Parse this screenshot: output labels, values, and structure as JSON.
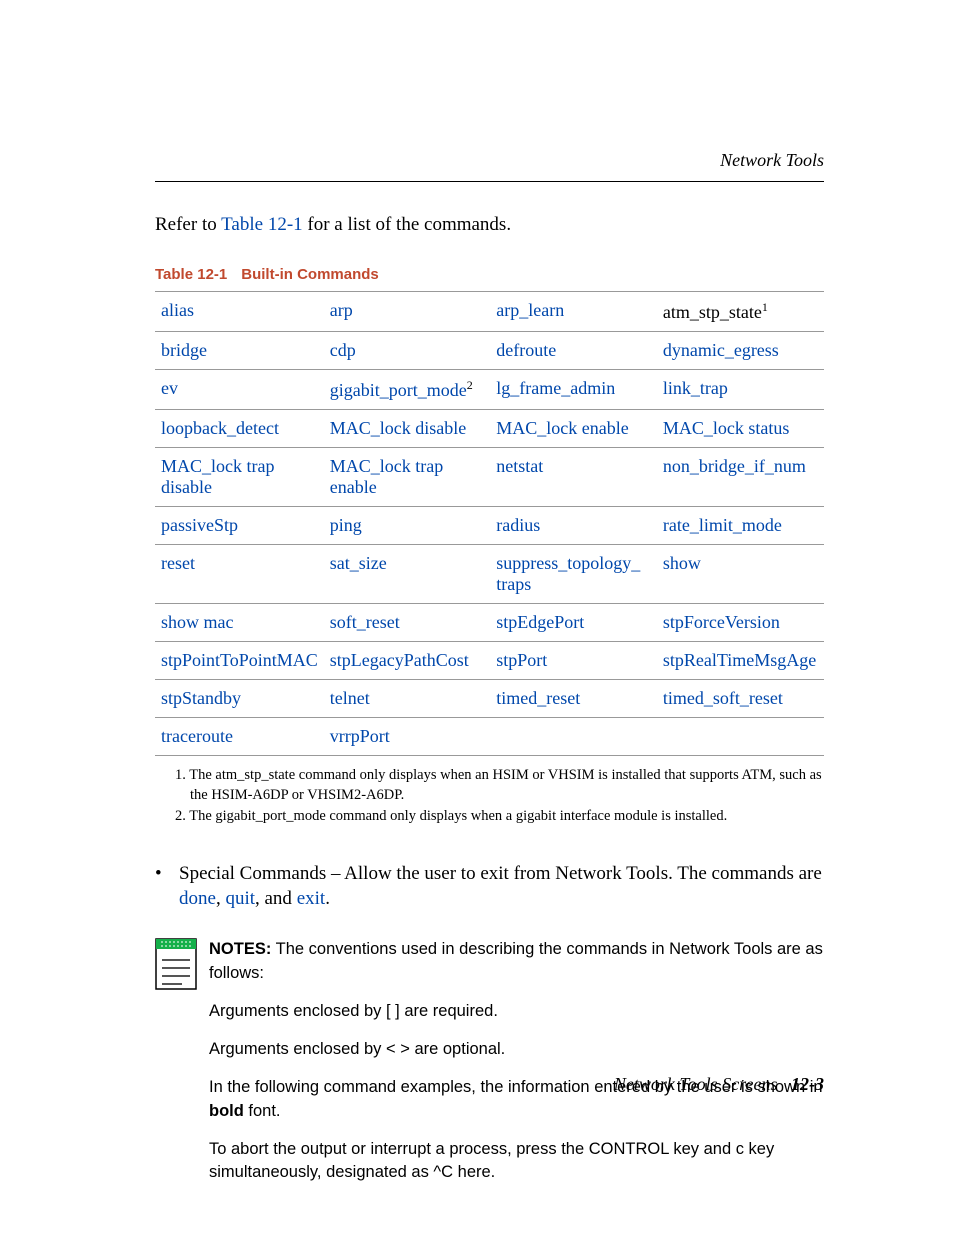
{
  "header": {
    "section": "Network Tools"
  },
  "intro": {
    "pre": "Refer to ",
    "link": "Table 12-1",
    "post": " for a list of the commands."
  },
  "table": {
    "number": "Table 12-1",
    "title": "Built-in Commands",
    "rows": [
      [
        {
          "t": "alias",
          "sup": ""
        },
        {
          "t": "arp",
          "sup": ""
        },
        {
          "t": "arp_learn",
          "sup": ""
        },
        {
          "t": "atm_stp_state",
          "sup": "1",
          "plain": true
        }
      ],
      [
        {
          "t": "bridge",
          "sup": ""
        },
        {
          "t": "cdp",
          "sup": ""
        },
        {
          "t": "defroute",
          "sup": ""
        },
        {
          "t": "dynamic_egress",
          "sup": ""
        }
      ],
      [
        {
          "t": "ev",
          "sup": ""
        },
        {
          "t": "gigabit_port_mode",
          "sup": "2"
        },
        {
          "t": "lg_frame_admin",
          "sup": ""
        },
        {
          "t": "link_trap",
          "sup": ""
        }
      ],
      [
        {
          "t": "loopback_detect",
          "sup": ""
        },
        {
          "t": "MAC_lock disable",
          "sup": ""
        },
        {
          "t": "MAC_lock enable",
          "sup": ""
        },
        {
          "t": "MAC_lock status",
          "sup": ""
        }
      ],
      [
        {
          "t": "MAC_lock trap disable",
          "sup": ""
        },
        {
          "t": "MAC_lock trap enable",
          "sup": ""
        },
        {
          "t": "netstat",
          "sup": ""
        },
        {
          "t": "non_bridge_if_num",
          "sup": ""
        }
      ],
      [
        {
          "t": "passiveStp",
          "sup": ""
        },
        {
          "t": "ping",
          "sup": ""
        },
        {
          "t": "radius",
          "sup": ""
        },
        {
          "t": "rate_limit_mode",
          "sup": ""
        }
      ],
      [
        {
          "t": "reset",
          "sup": ""
        },
        {
          "t": "sat_size",
          "sup": ""
        },
        {
          "t": "suppress_topology_ traps",
          "sup": ""
        },
        {
          "t": "show",
          "sup": ""
        }
      ],
      [
        {
          "t": "show mac",
          "sup": ""
        },
        {
          "t": "soft_reset",
          "sup": ""
        },
        {
          "t": "stpEdgePort",
          "sup": ""
        },
        {
          "t": "stpForceVersion",
          "sup": ""
        }
      ],
      [
        {
          "t": "stpPointToPointMAC",
          "sup": ""
        },
        {
          "t": "stpLegacyPathCost",
          "sup": ""
        },
        {
          "t": "stpPort",
          "sup": ""
        },
        {
          "t": "stpRealTimeMsgAge",
          "sup": ""
        }
      ],
      [
        {
          "t": "stpStandby",
          "sup": ""
        },
        {
          "t": "telnet",
          "sup": ""
        },
        {
          "t": "timed_reset",
          "sup": ""
        },
        {
          "t": "timed_soft_reset",
          "sup": ""
        }
      ],
      [
        {
          "t": "traceroute",
          "sup": ""
        },
        {
          "t": "vrrpPort",
          "sup": ""
        },
        {
          "t": "",
          "sup": ""
        },
        {
          "t": "",
          "sup": ""
        }
      ]
    ]
  },
  "footnotes": [
    "1. The atm_stp_state command only displays when an HSIM or VHSIM is installed that supports ATM, such as the HSIM-A6DP or VHSIM2-A6DP.",
    "2. The gigabit_port_mode command only displays when a gigabit interface module is installed."
  ],
  "bullet": {
    "pre": "Special Commands – Allow the user to exit from Network Tools. The commands are ",
    "l1": "done",
    "c1": ", ",
    "l2": "quit",
    "c2": ", and ",
    "l3": "exit",
    "post": "."
  },
  "notes": {
    "label": "NOTES:",
    "p1_rest": " The conventions used in describing the commands in Network Tools are as follows:",
    "p2": "Arguments enclosed by [ ] are required.",
    "p3": "Arguments enclosed by < > are optional.",
    "p4_a": "In the following command examples, the information entered by the user is shown in ",
    "p4_bold": "bold",
    "p4_b": " font.",
    "p5": "To abort the output or interrupt a process, press the CONTROL key and c key simultaneously, designated as ^C here."
  },
  "footer": {
    "title": "Network Tools Screens",
    "page": "12-3"
  }
}
